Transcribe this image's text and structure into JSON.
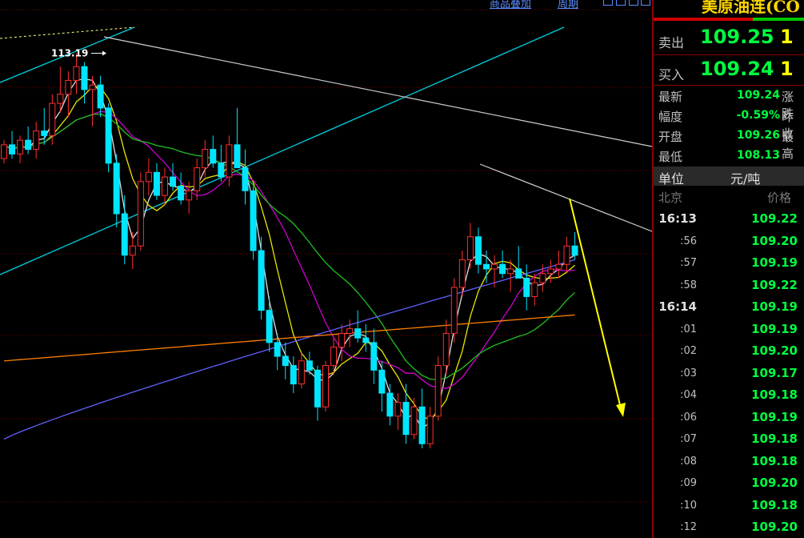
{
  "toolbar": {
    "overlay_label": "商品叠加",
    "period_label": "周期"
  },
  "panel": {
    "title": "美原油连(CO",
    "sell_label": "卖出",
    "sell_price": "109.25",
    "sell_vol": "1",
    "buy_label": "买入",
    "buy_price": "109.24",
    "buy_vol": "1",
    "stats": [
      {
        "label": "最新",
        "value": "109.24",
        "label2": "涨跌"
      },
      {
        "label": "幅度",
        "value": "-0.59%",
        "label2": "昨收"
      },
      {
        "label": "开盘",
        "value": "109.26",
        "label2": "最高"
      },
      {
        "label": "最低",
        "value": "108.13",
        "label2": ""
      }
    ],
    "unit_label": "单位",
    "unit_value": "元/吨",
    "tick_header_left": "北京",
    "tick_header_right": "价格",
    "ticks": [
      {
        "time": "16:13",
        "price": "109.22",
        "big": true
      },
      {
        "time": ":56",
        "price": "109.20"
      },
      {
        "time": ":57",
        "price": "109.19"
      },
      {
        "time": ":58",
        "price": "109.22"
      },
      {
        "time": "16:14",
        "price": "109.19",
        "big": true
      },
      {
        "time": ":01",
        "price": "109.19"
      },
      {
        "time": ":02",
        "price": "109.20"
      },
      {
        "time": ":03",
        "price": "109.17"
      },
      {
        "time": ":04",
        "price": "109.18"
      },
      {
        "time": ":06",
        "price": "109.19"
      },
      {
        "time": ":07",
        "price": "109.18"
      },
      {
        "time": ":08",
        "price": "109.18"
      },
      {
        "time": ":09",
        "price": "109.20"
      },
      {
        "time": ":10",
        "price": "109.18"
      },
      {
        "time": ":12",
        "price": "109.20"
      }
    ]
  },
  "colors": {
    "up": "#ff3030",
    "down": "#00e5ff",
    "accent_green": "#00ff40",
    "label_yellow": "#ffff00",
    "grid": "#8b0000"
  },
  "chart_data": {
    "type": "candlestick",
    "annotations": [
      {
        "text": "113.19",
        "series_index": 9
      }
    ],
    "ylim": [
      104.6,
      114.0
    ],
    "candles": [
      [
        110.9,
        111.3,
        110.8,
        111.2
      ],
      [
        111.2,
        111.5,
        110.9,
        111.0
      ],
      [
        111.0,
        111.4,
        110.8,
        111.3
      ],
      [
        111.3,
        111.6,
        111.0,
        111.1
      ],
      [
        111.1,
        111.7,
        110.9,
        111.5
      ],
      [
        111.5,
        112.0,
        111.2,
        111.4
      ],
      [
        111.4,
        112.3,
        111.2,
        112.1
      ],
      [
        112.1,
        112.9,
        111.9,
        112.3
      ],
      [
        112.3,
        112.8,
        111.8,
        112.6
      ],
      [
        112.6,
        113.19,
        112.3,
        112.9
      ],
      [
        112.9,
        113.0,
        112.1,
        112.4
      ],
      [
        112.4,
        112.7,
        111.6,
        112.5
      ],
      [
        112.5,
        112.7,
        111.8,
        112.0
      ],
      [
        112.0,
        112.1,
        110.6,
        110.8
      ],
      [
        110.8,
        111.0,
        109.4,
        109.7
      ],
      [
        109.7,
        110.1,
        108.6,
        108.8
      ],
      [
        108.8,
        109.3,
        108.5,
        109.0
      ],
      [
        109.0,
        110.6,
        108.9,
        110.4
      ],
      [
        110.4,
        110.9,
        110.1,
        110.6
      ],
      [
        110.6,
        110.8,
        110.0,
        110.1
      ],
      [
        110.1,
        110.7,
        109.9,
        110.5
      ],
      [
        110.5,
        110.8,
        110.2,
        110.3
      ],
      [
        110.3,
        110.6,
        109.9,
        110.0
      ],
      [
        110.0,
        110.4,
        109.7,
        110.2
      ],
      [
        110.2,
        110.9,
        110.0,
        110.7
      ],
      [
        110.7,
        111.3,
        110.5,
        111.1
      ],
      [
        111.1,
        111.4,
        110.7,
        110.8
      ],
      [
        110.8,
        111.2,
        110.4,
        110.5
      ],
      [
        110.5,
        111.4,
        110.3,
        111.2
      ],
      [
        111.2,
        112.0,
        110.9,
        110.7
      ],
      [
        110.7,
        111.1,
        109.9,
        110.2
      ],
      [
        110.2,
        110.3,
        108.7,
        108.9
      ],
      [
        108.9,
        109.2,
        107.4,
        107.6
      ],
      [
        107.6,
        107.9,
        106.7,
        106.9
      ],
      [
        106.9,
        107.1,
        106.3,
        106.6
      ],
      [
        106.6,
        106.9,
        106.1,
        106.4
      ],
      [
        106.4,
        106.6,
        105.8,
        106.0
      ],
      [
        106.0,
        106.7,
        105.9,
        106.5
      ],
      [
        106.5,
        106.7,
        106.2,
        106.3
      ],
      [
        106.3,
        106.4,
        105.2,
        105.5
      ],
      [
        105.5,
        106.5,
        105.4,
        106.4
      ],
      [
        106.4,
        107.0,
        106.2,
        106.8
      ],
      [
        106.8,
        107.3,
        106.5,
        107.1
      ],
      [
        107.1,
        107.4,
        106.8,
        107.2
      ],
      [
        107.2,
        107.6,
        106.9,
        107.0
      ],
      [
        107.0,
        107.3,
        106.7,
        106.9
      ],
      [
        106.9,
        107.2,
        106.0,
        106.3
      ],
      [
        106.3,
        106.5,
        105.4,
        105.8
      ],
      [
        105.8,
        106.0,
        105.1,
        105.3
      ],
      [
        105.3,
        105.8,
        105.0,
        105.6
      ],
      [
        105.6,
        106.0,
        104.7,
        104.9
      ],
      [
        104.9,
        105.7,
        104.8,
        105.5
      ],
      [
        105.5,
        105.9,
        104.6,
        104.7
      ],
      [
        104.7,
        105.5,
        104.6,
        105.3
      ],
      [
        105.3,
        106.6,
        105.2,
        106.4
      ],
      [
        106.4,
        107.4,
        106.2,
        107.1
      ],
      [
        107.1,
        108.3,
        106.9,
        108.1
      ],
      [
        108.1,
        108.9,
        107.9,
        108.7
      ],
      [
        108.7,
        109.5,
        108.5,
        109.2
      ],
      [
        109.2,
        109.4,
        108.4,
        108.6
      ],
      [
        108.6,
        108.9,
        108.2,
        108.5
      ],
      [
        108.5,
        108.8,
        108.1,
        108.6
      ],
      [
        108.6,
        108.9,
        108.3,
        108.4
      ],
      [
        108.4,
        108.7,
        108.0,
        108.5
      ],
      [
        108.5,
        109.0,
        108.3,
        108.3
      ],
      [
        108.3,
        108.6,
        107.6,
        107.9
      ],
      [
        107.9,
        108.4,
        107.7,
        108.2
      ],
      [
        108.2,
        108.6,
        108.0,
        108.4
      ],
      [
        108.4,
        108.7,
        108.2,
        108.5
      ],
      [
        108.5,
        108.9,
        108.3,
        108.6
      ],
      [
        108.6,
        109.2,
        108.4,
        109.0
      ],
      [
        109.0,
        109.3,
        108.7,
        108.8
      ]
    ],
    "ma_fast_color": "#e0e0e0",
    "ma5_color": "#e8e800",
    "ma10_color": "#d000d0",
    "ma20_color": "#20c020",
    "ma60_color": "#6060ff",
    "ma120_color": "#ff8000"
  }
}
